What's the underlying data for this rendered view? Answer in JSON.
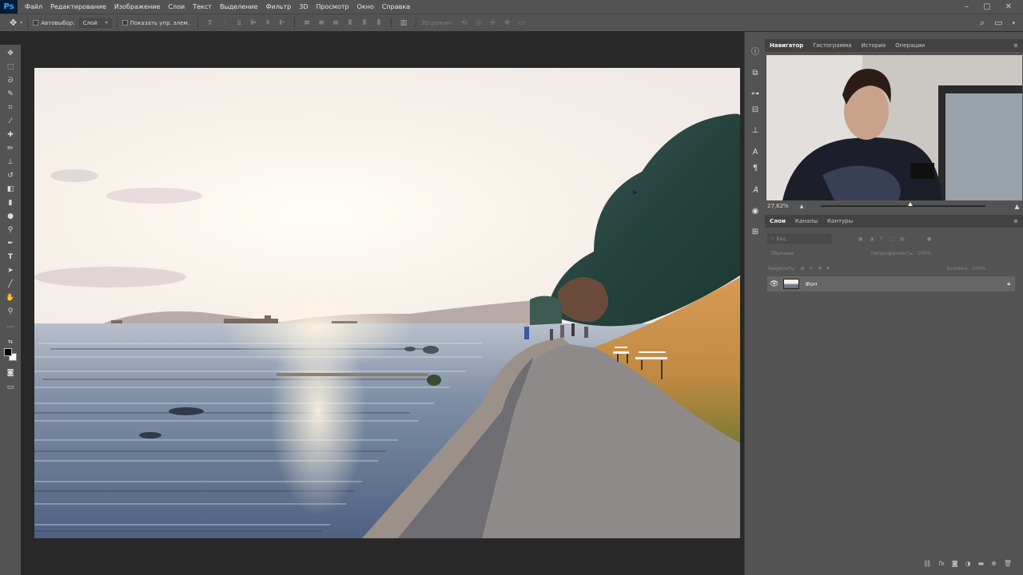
{
  "menubar": {
    "logo": "Ps",
    "items": [
      "Файл",
      "Редактирование",
      "Изображение",
      "Слои",
      "Текст",
      "Выделение",
      "Фильтр",
      "3D",
      "Просмотр",
      "Окно",
      "Справка"
    ],
    "window_controls": [
      "–",
      "▢",
      "✕"
    ]
  },
  "options": {
    "autoselect_label": "Автовыбор:",
    "autoselect_value": "Слой",
    "show_transform_label": "Показать упр. элем.",
    "mode_3d_label": "3D-режим:"
  },
  "navigator": {
    "tabs": [
      "Навигатор",
      "Гистограмма",
      "История",
      "Операции"
    ],
    "zoom_value": "27,62%",
    "zoom_level": 0.54
  },
  "layers": {
    "tabs": [
      "Слои",
      "Каналы",
      "Контуры"
    ],
    "filter_placeholder": "Вид",
    "blend_mode": "Обычные",
    "opacity_label": "Непрозрачность:",
    "opacity_value": "100%",
    "lock_label": "Закрепить:",
    "fill_label": "Заливка:",
    "fill_value": "100%",
    "layer_name": "Фон"
  },
  "colors": {
    "panel_bg": "#535353",
    "canvas_bg": "#282828",
    "accent": "#31a8ff"
  }
}
